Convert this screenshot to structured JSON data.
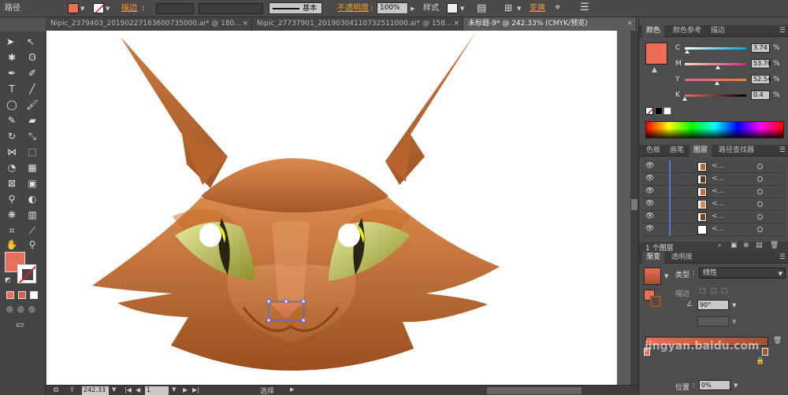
{
  "control_bar": {
    "path_label": "路径",
    "stroke_label": "描边",
    "brush_label": "基本",
    "opacity_label": "不透明度",
    "opacity_value": "100%",
    "style_label": "样式",
    "transform_label": "变换",
    "fill_color": "#e8705a"
  },
  "tabs": [
    {
      "label": "Nipic_2379403_20190227163600735000.ai* @ 180...",
      "close": "×"
    },
    {
      "label": "Nipic_27737901_20190304110732511000.ai* @ 158...",
      "close": "×"
    },
    {
      "label": "未标题-9* @ 242.33% (CMYK/预览)",
      "close": "×"
    }
  ],
  "color_panel": {
    "tabs": [
      "颜色",
      "颜色参考",
      "描边"
    ],
    "sliders": [
      {
        "label": "C",
        "value": "3.74",
        "unit": "%",
        "fraction": 0.04,
        "grad": "linear-gradient(to right,#ffffff,#00a0e0)"
      },
      {
        "label": "M",
        "value": "53.76",
        "unit": "%",
        "fraction": 0.54,
        "grad": "linear-gradient(to right,#f5e0c0,#e02080)"
      },
      {
        "label": "Y",
        "value": "52.54",
        "unit": "%",
        "fraction": 0.53,
        "grad": "linear-gradient(to right,#e060a0,#f08030)"
      },
      {
        "label": "K",
        "value": "0.4",
        "unit": "%",
        "fraction": 0.0,
        "grad": "linear-gradient(to right,#f07060,#000000)"
      }
    ],
    "swatch_color": "#ee6b57"
  },
  "layers_panel": {
    "tabs": [
      "色板",
      "画笔",
      "图层",
      "路径查找器"
    ],
    "rows": [
      {
        "name": "<..."
      },
      {
        "name": "<..."
      },
      {
        "name": "<..."
      },
      {
        "name": "<..."
      },
      {
        "name": "<..."
      },
      {
        "name": "<..."
      }
    ],
    "footer": "1 个图层"
  },
  "gradient_panel": {
    "tabs": [
      "渐变",
      "透明度"
    ],
    "type_label": "类型",
    "type_value": "线性",
    "stroke_label": "描边",
    "angle_value": "90°",
    "location_label": "位置",
    "location_value": "0%",
    "start_color": "#ee6b57",
    "end_color": "#a0522d"
  },
  "status_bar": {
    "zoom": "242.33",
    "page": "1",
    "tool_name": "选择"
  },
  "watermark": "jingyan.baidu.com"
}
